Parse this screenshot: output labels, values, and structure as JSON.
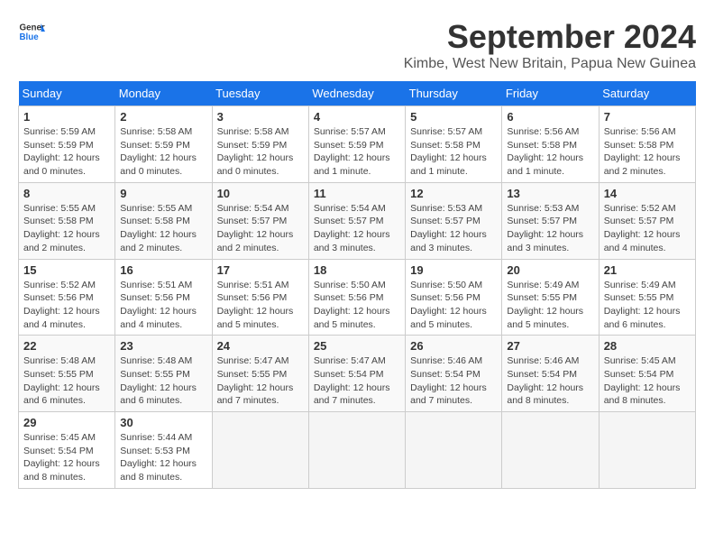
{
  "header": {
    "logo_line1": "General",
    "logo_line2": "Blue",
    "month": "September 2024",
    "location": "Kimbe, West New Britain, Papua New Guinea"
  },
  "weekdays": [
    "Sunday",
    "Monday",
    "Tuesday",
    "Wednesday",
    "Thursday",
    "Friday",
    "Saturday"
  ],
  "weeks": [
    [
      {
        "day": "1",
        "sunrise": "5:59 AM",
        "sunset": "5:59 PM",
        "daylight": "12 hours and 0 minutes."
      },
      {
        "day": "2",
        "sunrise": "5:58 AM",
        "sunset": "5:59 PM",
        "daylight": "12 hours and 0 minutes."
      },
      {
        "day": "3",
        "sunrise": "5:58 AM",
        "sunset": "5:59 PM",
        "daylight": "12 hours and 0 minutes."
      },
      {
        "day": "4",
        "sunrise": "5:57 AM",
        "sunset": "5:59 PM",
        "daylight": "12 hours and 1 minute."
      },
      {
        "day": "5",
        "sunrise": "5:57 AM",
        "sunset": "5:58 PM",
        "daylight": "12 hours and 1 minute."
      },
      {
        "day": "6",
        "sunrise": "5:56 AM",
        "sunset": "5:58 PM",
        "daylight": "12 hours and 1 minute."
      },
      {
        "day": "7",
        "sunrise": "5:56 AM",
        "sunset": "5:58 PM",
        "daylight": "12 hours and 2 minutes."
      }
    ],
    [
      {
        "day": "8",
        "sunrise": "5:55 AM",
        "sunset": "5:58 PM",
        "daylight": "12 hours and 2 minutes."
      },
      {
        "day": "9",
        "sunrise": "5:55 AM",
        "sunset": "5:58 PM",
        "daylight": "12 hours and 2 minutes."
      },
      {
        "day": "10",
        "sunrise": "5:54 AM",
        "sunset": "5:57 PM",
        "daylight": "12 hours and 2 minutes."
      },
      {
        "day": "11",
        "sunrise": "5:54 AM",
        "sunset": "5:57 PM",
        "daylight": "12 hours and 3 minutes."
      },
      {
        "day": "12",
        "sunrise": "5:53 AM",
        "sunset": "5:57 PM",
        "daylight": "12 hours and 3 minutes."
      },
      {
        "day": "13",
        "sunrise": "5:53 AM",
        "sunset": "5:57 PM",
        "daylight": "12 hours and 3 minutes."
      },
      {
        "day": "14",
        "sunrise": "5:52 AM",
        "sunset": "5:57 PM",
        "daylight": "12 hours and 4 minutes."
      }
    ],
    [
      {
        "day": "15",
        "sunrise": "5:52 AM",
        "sunset": "5:56 PM",
        "daylight": "12 hours and 4 minutes."
      },
      {
        "day": "16",
        "sunrise": "5:51 AM",
        "sunset": "5:56 PM",
        "daylight": "12 hours and 4 minutes."
      },
      {
        "day": "17",
        "sunrise": "5:51 AM",
        "sunset": "5:56 PM",
        "daylight": "12 hours and 5 minutes."
      },
      {
        "day": "18",
        "sunrise": "5:50 AM",
        "sunset": "5:56 PM",
        "daylight": "12 hours and 5 minutes."
      },
      {
        "day": "19",
        "sunrise": "5:50 AM",
        "sunset": "5:56 PM",
        "daylight": "12 hours and 5 minutes."
      },
      {
        "day": "20",
        "sunrise": "5:49 AM",
        "sunset": "5:55 PM",
        "daylight": "12 hours and 5 minutes."
      },
      {
        "day": "21",
        "sunrise": "5:49 AM",
        "sunset": "5:55 PM",
        "daylight": "12 hours and 6 minutes."
      }
    ],
    [
      {
        "day": "22",
        "sunrise": "5:48 AM",
        "sunset": "5:55 PM",
        "daylight": "12 hours and 6 minutes."
      },
      {
        "day": "23",
        "sunrise": "5:48 AM",
        "sunset": "5:55 PM",
        "daylight": "12 hours and 6 minutes."
      },
      {
        "day": "24",
        "sunrise": "5:47 AM",
        "sunset": "5:55 PM",
        "daylight": "12 hours and 7 minutes."
      },
      {
        "day": "25",
        "sunrise": "5:47 AM",
        "sunset": "5:54 PM",
        "daylight": "12 hours and 7 minutes."
      },
      {
        "day": "26",
        "sunrise": "5:46 AM",
        "sunset": "5:54 PM",
        "daylight": "12 hours and 7 minutes."
      },
      {
        "day": "27",
        "sunrise": "5:46 AM",
        "sunset": "5:54 PM",
        "daylight": "12 hours and 8 minutes."
      },
      {
        "day": "28",
        "sunrise": "5:45 AM",
        "sunset": "5:54 PM",
        "daylight": "12 hours and 8 minutes."
      }
    ],
    [
      {
        "day": "29",
        "sunrise": "5:45 AM",
        "sunset": "5:54 PM",
        "daylight": "12 hours and 8 minutes."
      },
      {
        "day": "30",
        "sunrise": "5:44 AM",
        "sunset": "5:53 PM",
        "daylight": "12 hours and 8 minutes."
      },
      null,
      null,
      null,
      null,
      null
    ]
  ],
  "labels": {
    "sunrise": "Sunrise:",
    "sunset": "Sunset:",
    "daylight": "Daylight:"
  }
}
